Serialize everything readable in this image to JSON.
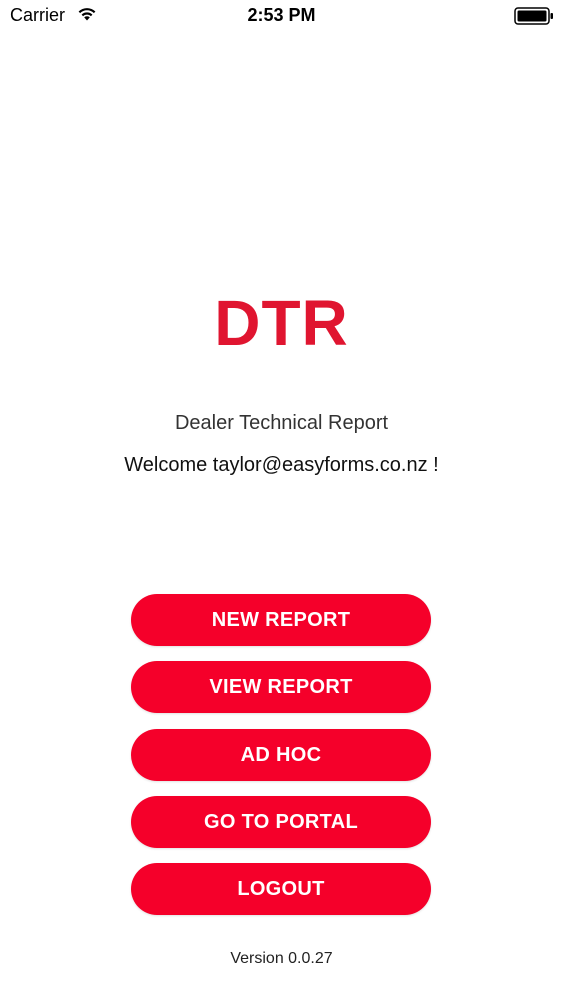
{
  "status_bar": {
    "carrier": "Carrier",
    "time": "2:53 PM"
  },
  "app": {
    "logo": "DTR",
    "subtitle": "Dealer Technical Report",
    "welcome": "Welcome taylor@easyforms.co.nz !",
    "version": "Version 0.0.27"
  },
  "buttons": {
    "new_report": "NEW REPORT",
    "view_report": "VIEW REPORT",
    "ad_hoc": "AD HOC",
    "go_to_portal": "GO TO PORTAL",
    "logout": "LOGOUT"
  },
  "colors": {
    "brand": "#e01530",
    "button": "#f5002a",
    "button_text": "#ffffff"
  },
  "icons": {
    "wifi": "wifi-icon",
    "battery": "battery-icon"
  }
}
